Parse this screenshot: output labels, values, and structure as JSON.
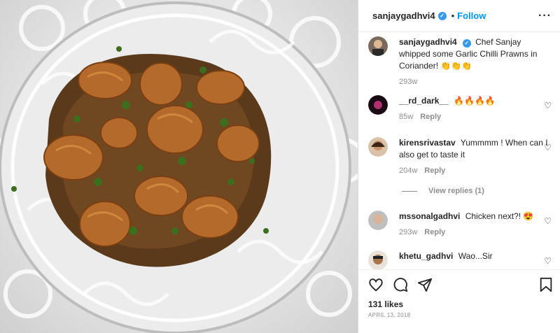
{
  "post": {
    "author": "sanjaygadhvi4",
    "dot": "•",
    "follow_label": "Follow",
    "more_icon": "more-options-icon",
    "verified_icon": "verified-badge-icon",
    "caption": {
      "author": "sanjaygadhvi4",
      "text": "Chef Sanjay whipped some Garlic Chilli Prawns in Coriander! 👏👏👏",
      "time": "293w"
    },
    "comments": [
      {
        "user": "__rd_dark__",
        "text": "🔥🔥🔥🔥",
        "time": "85w",
        "reply": "Reply"
      },
      {
        "user": "kirensrivastav",
        "text": "Yummmm ! When can I also get to taste it",
        "time": "204w",
        "reply": "Reply"
      },
      {
        "user": "mssonalgadhvi",
        "text": "Chicken next?! 😍",
        "time": "293w",
        "reply": "Reply"
      },
      {
        "user": "khetu_gadhvi",
        "text": "Wao...Sir",
        "time": "",
        "reply": ""
      }
    ],
    "view_replies": "View replies (1)",
    "likes": "131 likes",
    "date": "APRIL 13, 2018",
    "action_icons": [
      "heart-icon",
      "comment-icon",
      "share-icon",
      "bookmark-icon"
    ]
  }
}
